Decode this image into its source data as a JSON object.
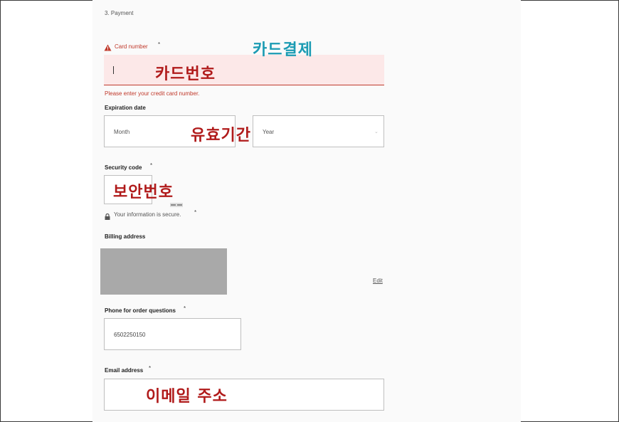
{
  "section": {
    "title": "3. Payment"
  },
  "card": {
    "label": "Card number",
    "required_mark": "*",
    "error_message": "Please enter your credit card number."
  },
  "expiration": {
    "label": "Expiration date",
    "month_placeholder": "Month",
    "year_placeholder": "Year"
  },
  "security": {
    "label": "Security code",
    "required_mark": "*",
    "secure_note": "Your information is secure.",
    "secure_required_mark": "*"
  },
  "billing": {
    "label": "Billing address",
    "edit_label": "Edit"
  },
  "phone": {
    "label": "Phone for order questions",
    "required_mark": "*",
    "value": "6502250150"
  },
  "email": {
    "label": "Email address",
    "required_mark": "*"
  },
  "annotations": {
    "card_payment": "카드결제",
    "card_number": "카드번호",
    "expiry": "유효기간",
    "security_code": "보안번호",
    "email": "이메일 주소"
  },
  "colors": {
    "error": "#c0392b",
    "error_bg": "#fce8e8",
    "annotation_red": "#b01a1a",
    "annotation_teal": "#1b9bb3",
    "billing_placeholder": "#a9a9a9"
  }
}
